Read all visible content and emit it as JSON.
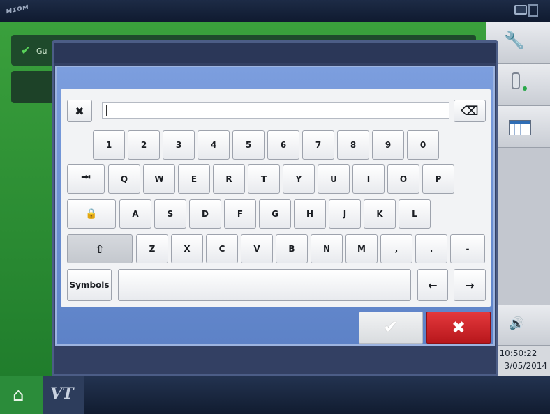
{
  "topbar": {
    "logo_text": "ᴍɪᴏᴍ"
  },
  "background": {
    "status_row_text": "Gu"
  },
  "clock": {
    "time": "10:50:22",
    "date": "3/05/2014"
  },
  "bottombar": {
    "vt_label": "VT"
  },
  "keyboard": {
    "text_value": "",
    "clear_icon": "✖",
    "backspace_icon": "⌫",
    "row1": [
      "1",
      "2",
      "3",
      "4",
      "5",
      "6",
      "7",
      "8",
      "9",
      "0"
    ],
    "tab_icon": "⭲",
    "row2": [
      "Q",
      "W",
      "E",
      "R",
      "T",
      "Y",
      "U",
      "I",
      "O",
      "P"
    ],
    "caps_icon": "🔒",
    "row3": [
      "A",
      "S",
      "D",
      "F",
      "G",
      "H",
      "J",
      "K",
      "L"
    ],
    "shift_icon": "⇧",
    "row4": [
      "Z",
      "X",
      "C",
      "V",
      "B",
      "N",
      "M",
      ",",
      ".",
      "-"
    ],
    "symbols_label": "Symbols",
    "left_arrow": "←",
    "right_arrow": "→"
  },
  "dialog": {
    "ok_icon": "✔",
    "cancel_icon": "✖"
  },
  "colors": {
    "accept_bg": "#dcdfe2",
    "cancel_bg": "#d02a2f",
    "dialog_blue": "#6b8fd6",
    "home_green": "#2b8c3a"
  }
}
